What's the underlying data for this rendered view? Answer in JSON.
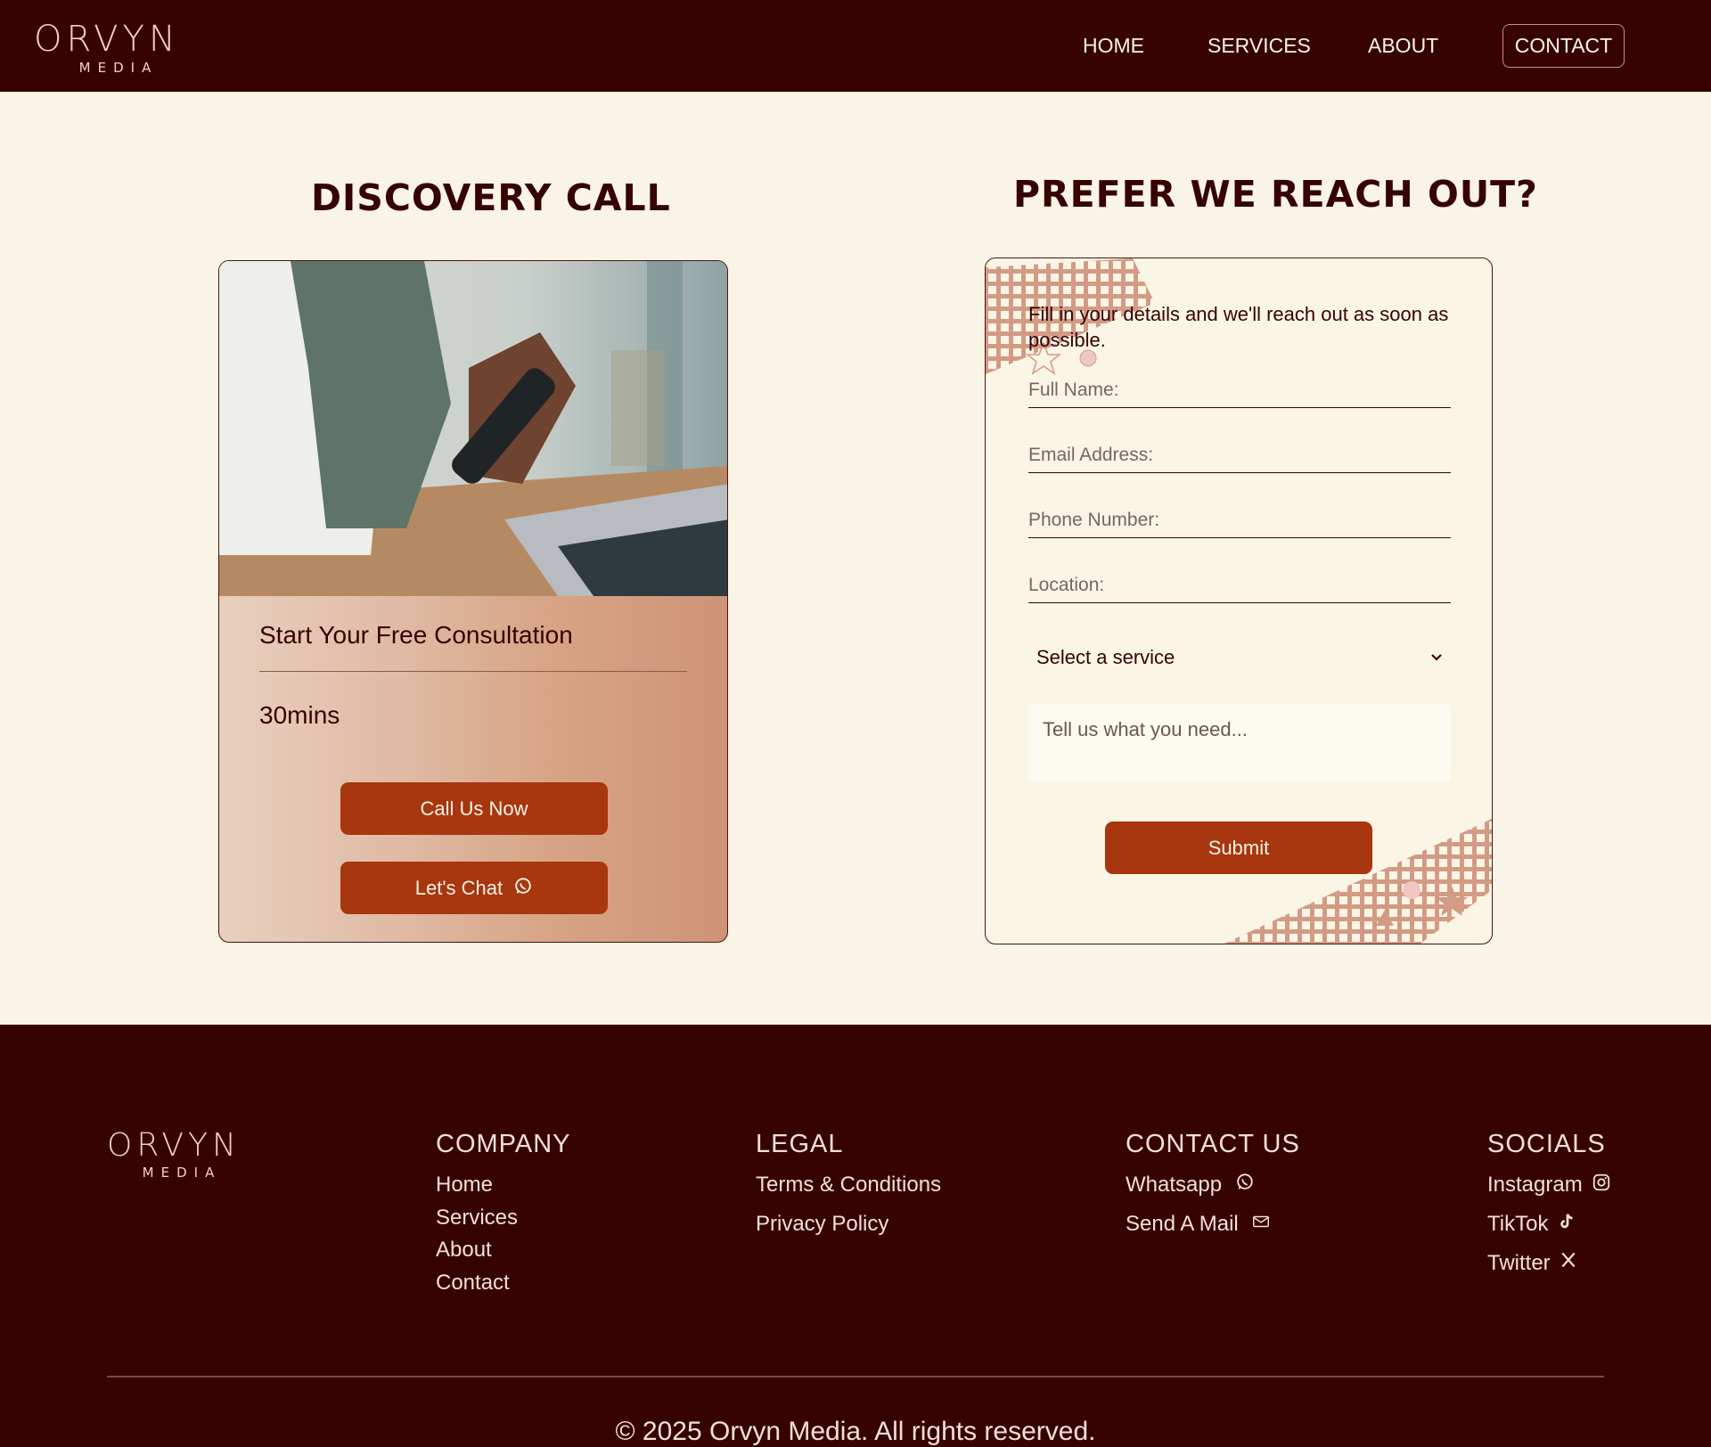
{
  "brand": {
    "name": "ORVYN",
    "sub": "MEDIA"
  },
  "nav": {
    "home": "HOME",
    "services": "SERVICES",
    "about": "ABOUT",
    "contact": "CONTACT"
  },
  "discovery": {
    "heading": "DISCOVERY CALL",
    "card_title": "Start Your Free Consultation",
    "duration": "30mins",
    "call_button": "Call Us Now",
    "chat_button": "Let's Chat"
  },
  "reach_out": {
    "heading": "PREFER WE REACH OUT?",
    "intro": "Fill in your details and we'll reach out as soon as possible.",
    "full_name_placeholder": "Full Name:",
    "email_placeholder": "Email Address:",
    "phone_placeholder": "Phone Number:",
    "location_placeholder": "Location:",
    "service_select": "Select a service",
    "message_placeholder": "Tell us what you need...",
    "submit": "Submit"
  },
  "footer": {
    "company": {
      "title": "COMPANY",
      "links": [
        "Home",
        "Services",
        "About",
        "Contact"
      ]
    },
    "legal": {
      "title": "LEGAL",
      "links": [
        "Terms & Conditions",
        "Privacy Policy"
      ]
    },
    "contact": {
      "title": "CONTACT US",
      "links": [
        "Whatsapp",
        "Send A Mail"
      ]
    },
    "socials": {
      "title": "SOCIALS",
      "links": [
        "Instagram",
        "TikTok",
        "Twitter"
      ]
    },
    "copyright": "© 2025 Orvyn Media. All rights reserved."
  },
  "icons": {
    "whatsapp": "whatsapp-icon",
    "mail": "mail-icon",
    "instagram": "instagram-icon",
    "tiktok": "tiktok-icon",
    "twitter": "x-twitter-icon",
    "chevron": "chevron-down-icon"
  },
  "colors": {
    "nav_bg": "#360202",
    "page_bg": "#f9f4e6",
    "button": "#a8360e",
    "accent": "#d98a78"
  }
}
